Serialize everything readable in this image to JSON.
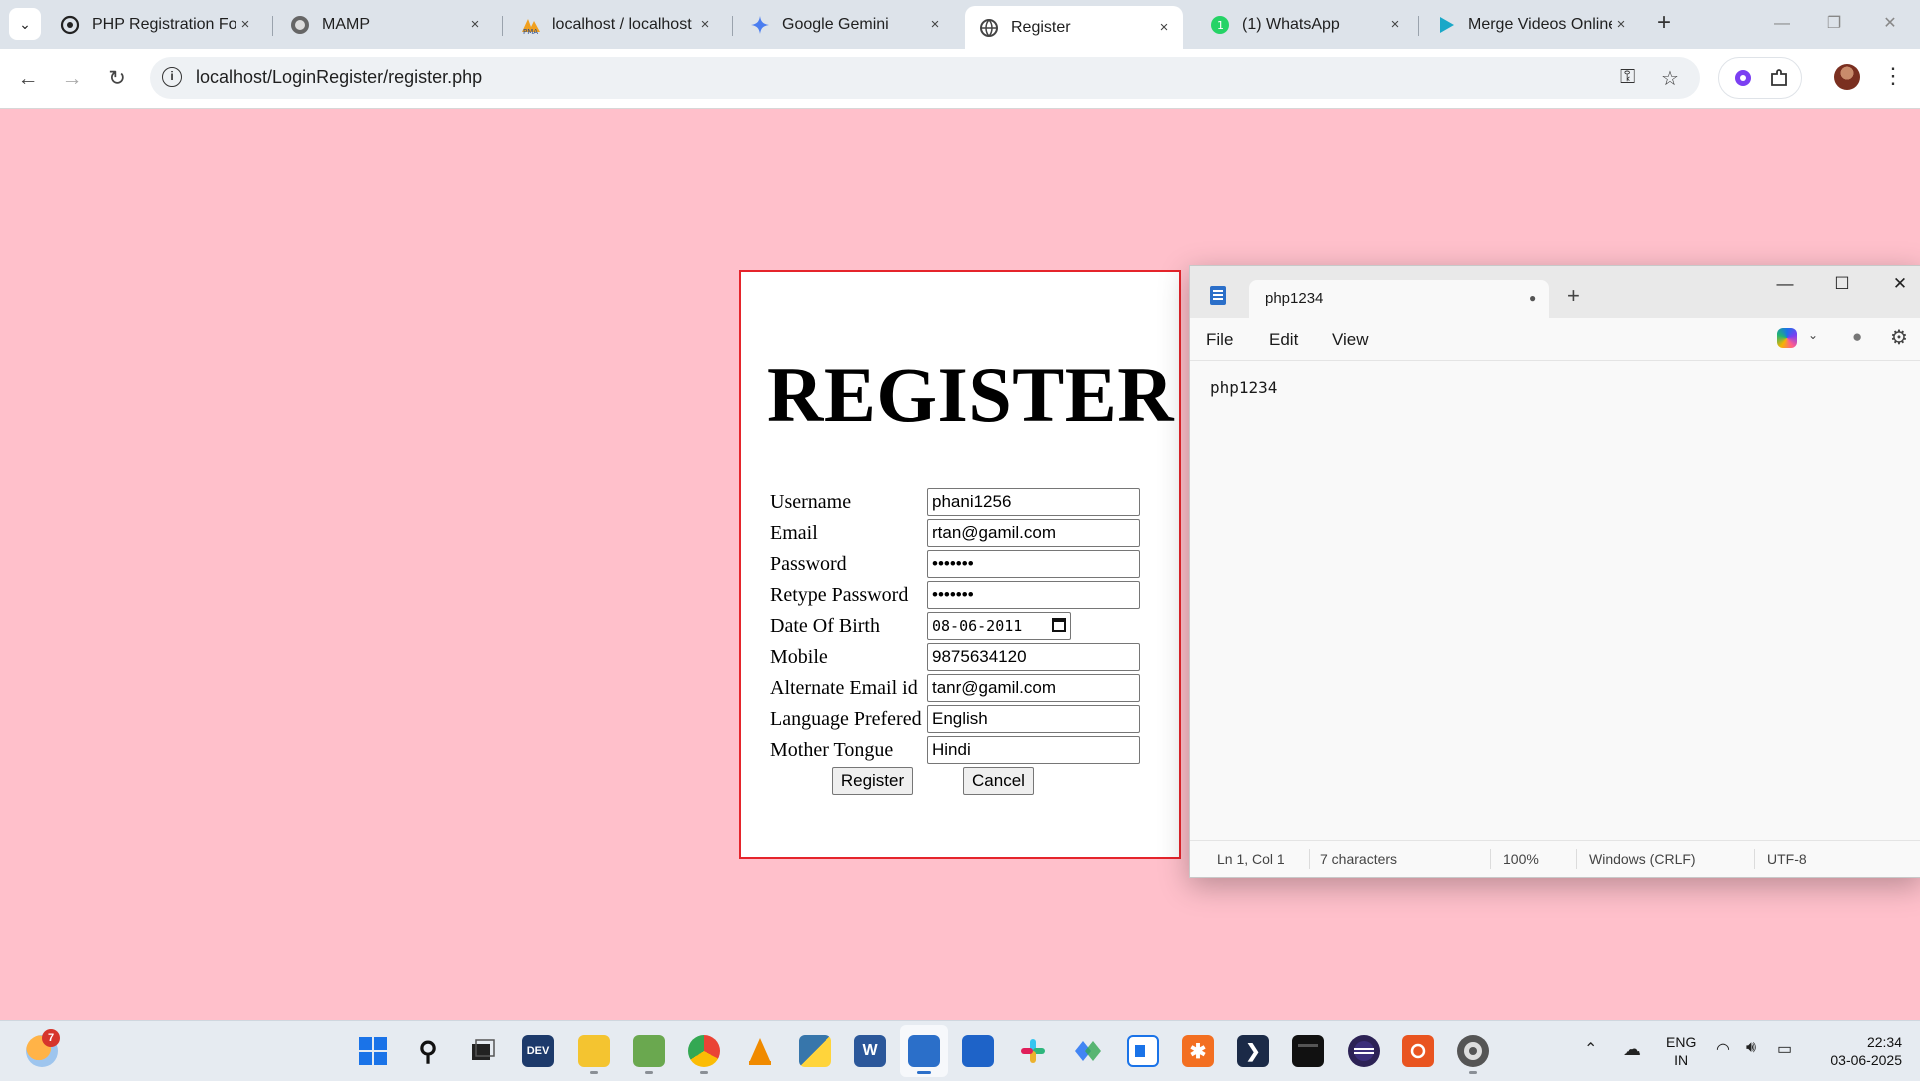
{
  "browser": {
    "tabs": [
      {
        "title": "PHP Registration For",
        "active": false
      },
      {
        "title": "MAMP",
        "active": false
      },
      {
        "title": "localhost / localhost",
        "active": false
      },
      {
        "title": "Google Gemini",
        "active": false
      },
      {
        "title": "Register",
        "active": true
      },
      {
        "title": "(1) WhatsApp",
        "active": false
      },
      {
        "title": "Merge Videos Online",
        "active": false
      }
    ],
    "url": "localhost/LoginRegister/register.php",
    "new_tab": "+",
    "close": "×"
  },
  "page": {
    "background": "#ffc0cb",
    "border_color": "#e5242b",
    "title": "REGISTER",
    "fields": [
      {
        "label": "Username",
        "value": "phani1256"
      },
      {
        "label": "Email",
        "value": "rtan@gamil.com"
      },
      {
        "label": "Password",
        "value": "•••••••"
      },
      {
        "label": "Retype Password",
        "value": "•••••••"
      },
      {
        "label": "Date Of Birth",
        "value": "08-06-2011"
      },
      {
        "label": "Mobile",
        "value": "9875634120"
      },
      {
        "label": "Alternate Email id",
        "value": "tanr@gamil.com"
      },
      {
        "label": "Language Prefered",
        "value": "English"
      },
      {
        "label": "Mother Tongue",
        "value": "Hindi"
      }
    ],
    "register_label": "Register",
    "cancel_label": "Cancel"
  },
  "notepad": {
    "tab_title": "php1234",
    "modified_indicator": "●",
    "new_tab": "+",
    "menus": [
      "File",
      "Edit",
      "View"
    ],
    "content": "php1234",
    "status": {
      "position": "Ln 1, Col 1",
      "chars": "7 characters",
      "zoom": "100%",
      "line_ending": "Windows (CRLF)",
      "encoding": "UTF-8"
    }
  },
  "taskbar": {
    "weather_badge": "7",
    "dev_label": "DEV",
    "language": "ENG",
    "region": "IN",
    "time": "22:34",
    "date": "03-06-2025"
  }
}
